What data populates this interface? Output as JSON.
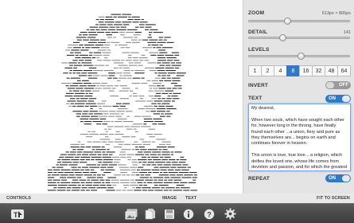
{
  "panel": {
    "zoom_label": "ZOOM",
    "zoom_value": "613px × 805px",
    "zoom_level": 0.38,
    "detail_label": "DETAIL",
    "detail_value": "141",
    "detail_level": 0.33,
    "levels_label": "LEVELS",
    "levels_level": 0.52,
    "level_options": [
      "1",
      "2",
      "4",
      "8",
      "16",
      "32",
      "48",
      "64"
    ],
    "level_selected": "8",
    "invert_label": "INVERT",
    "invert_state": "OFF",
    "text_label": "TEXT",
    "text_state": "ON",
    "text_content": "My dearest,\n\nWhen two souls, which have sought each other for, however long in the throng, have finally found each other ...a union, fiery and pure as they themselves are... begins on earth and continues forever in heaven.\n\nThis union is love, true love... a religion, which deifies the loved one, whose life comes from devotion and passion, and for which the greatest sacrifices are the sweetest delights.",
    "repeat_label": "REPEAT",
    "repeat_state": "ON"
  },
  "bottom": {
    "controls_label": "CONTROLS",
    "image_label": "IMAGE",
    "text_label": "TEXT",
    "fit_label": "FIT TO SCREEN"
  },
  "toolbar": {
    "icons": [
      "app-logo-icon",
      "photos-icon",
      "copy-icon",
      "save-icon",
      "info-icon",
      "help-icon",
      "gear-icon"
    ]
  },
  "colors": {
    "accent": "#2f79c9",
    "toolbar": "#4a4a4a"
  }
}
